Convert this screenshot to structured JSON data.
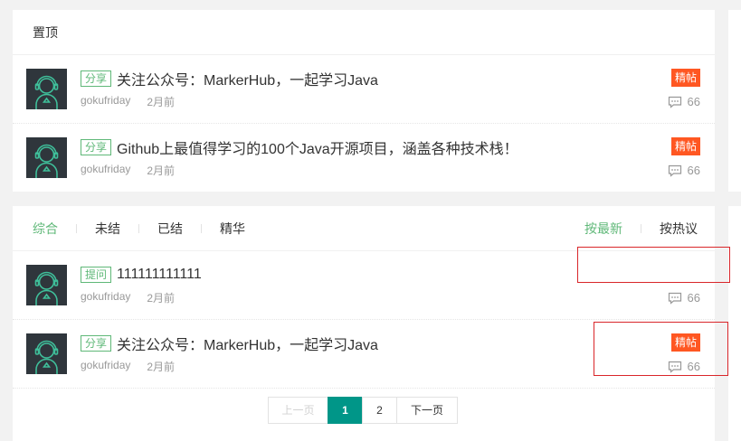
{
  "top_panel": {
    "title": "置顶",
    "posts": [
      {
        "tag": "分享",
        "title": "关注公众号：MarkerHub，一起学习Java",
        "author": "gokufriday",
        "time": "2月前",
        "badge": "精帖",
        "comments": "66"
      },
      {
        "tag": "分享",
        "title": "Github上最值得学习的100个Java开源项目，涵盖各种技术栈！",
        "author": "gokufriday",
        "time": "2月前",
        "badge": "精帖",
        "comments": "66"
      }
    ]
  },
  "filters": {
    "left": [
      "综合",
      "未结",
      "已结",
      "精华"
    ],
    "right": [
      "按最新",
      "按热议"
    ]
  },
  "list": {
    "posts": [
      {
        "tag": "提问",
        "title": "111111111111",
        "author": "gokufriday",
        "time": "2月前",
        "badge": "",
        "comments": "66"
      },
      {
        "tag": "分享",
        "title": "关注公众号：MarkerHub，一起学习Java",
        "author": "gokufriday",
        "time": "2月前",
        "badge": "精帖",
        "comments": "66"
      }
    ]
  },
  "pagination": {
    "prev": "上一页",
    "pages": [
      "1",
      "2"
    ],
    "current": "1",
    "next": "下一页"
  },
  "colors": {
    "accent_green": "#5FB878",
    "badge_orange": "#FF5722",
    "pager_active": "#009688",
    "highlight_red": "#d9262a"
  }
}
